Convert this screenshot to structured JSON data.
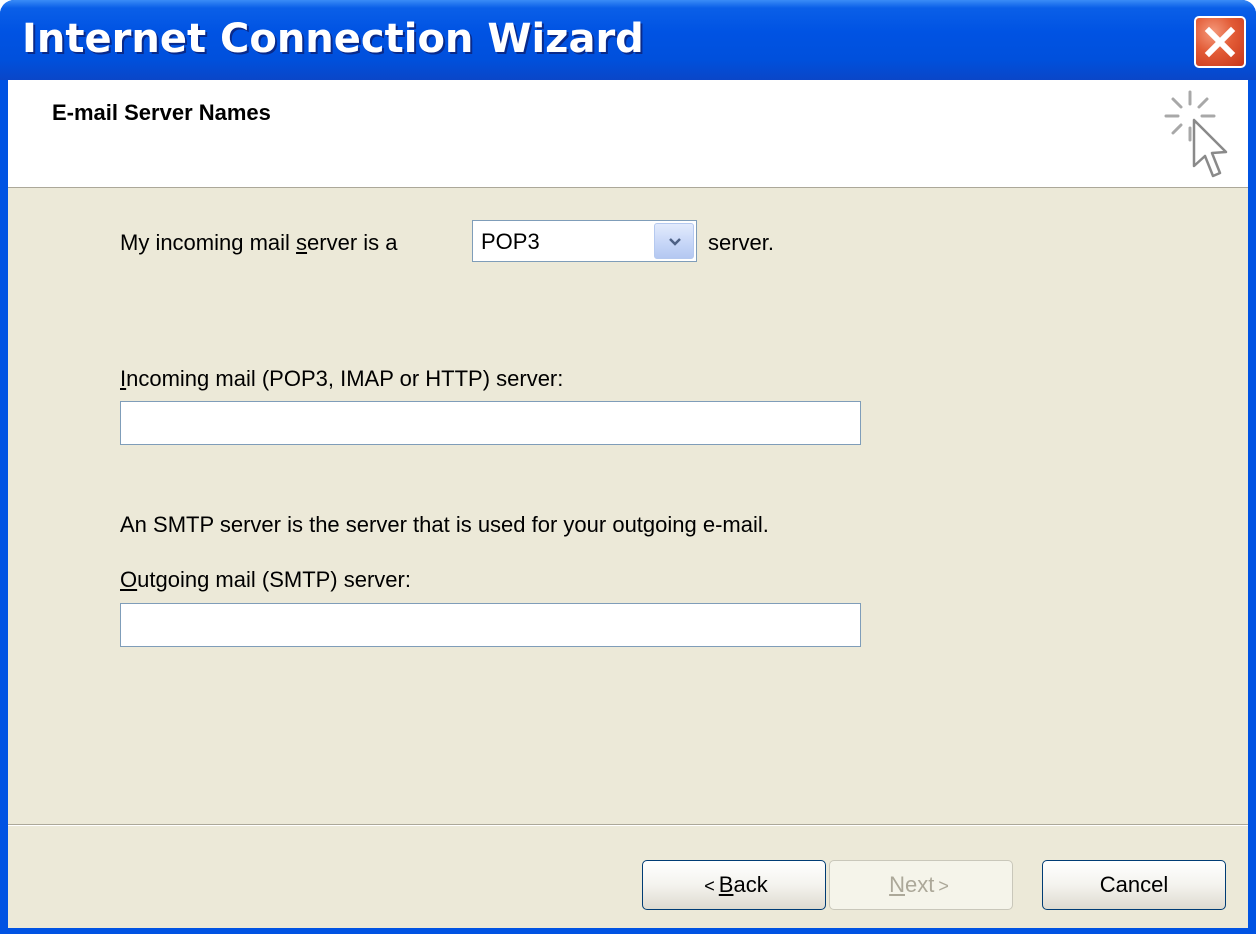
{
  "window": {
    "title": "Internet Connection Wizard",
    "close_icon": "close-icon"
  },
  "header": {
    "title": "E-mail Server Names",
    "icon": "wizard-sparkle-cursor-icon"
  },
  "server_type": {
    "label_before": "My incoming mail ",
    "label_underlined": "s",
    "label_after": "erver is a",
    "selected": "POP3",
    "suffix": "server."
  },
  "incoming": {
    "label_underlined": "I",
    "label_rest": "ncoming mail (POP3, IMAP or HTTP) server:",
    "value": ""
  },
  "smtp_note": "An SMTP server is the server that is used for your outgoing e-mail.",
  "outgoing": {
    "label_underlined": "O",
    "label_rest": "utgoing mail (SMTP) server:",
    "value": ""
  },
  "buttons": {
    "back_arrow": "<",
    "back_underlined": "B",
    "back_rest": "ack",
    "next_underlined": "N",
    "next_rest": "ext",
    "next_arrow": ">",
    "cancel": "Cancel"
  },
  "colors": {
    "titlebar": "#0053e3",
    "dialog_face": "#ece9d8",
    "close_button": "#e25b36"
  }
}
